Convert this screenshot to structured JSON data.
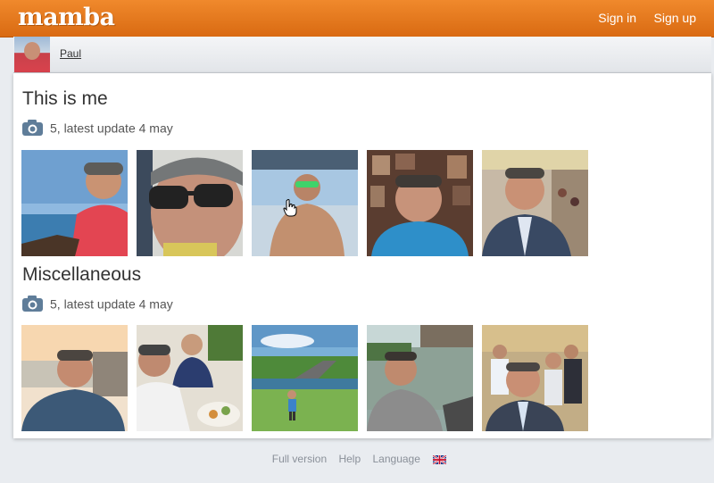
{
  "header": {
    "logo": "mamba",
    "sign_in": "Sign in",
    "sign_up": "Sign up",
    "brand_color": "#e57b20"
  },
  "user": {
    "name": "Paul"
  },
  "albums": [
    {
      "title": "This is me",
      "count_text": "5, latest update 4 may",
      "photos": [
        {
          "icon": "photo-man-red-shirt-sea"
        },
        {
          "icon": "photo-man-sunglasses-selfie"
        },
        {
          "icon": "photo-man-boat-green-glasses"
        },
        {
          "icon": "photo-man-blue-shirt-frames"
        },
        {
          "icon": "photo-man-suit-hall"
        }
      ]
    },
    {
      "title": "Miscellaneous",
      "count_text": "5, latest update 4 may",
      "photos": [
        {
          "icon": "photo-man-sunset-river"
        },
        {
          "icon": "photo-men-restaurant"
        },
        {
          "icon": "photo-road-landscape"
        },
        {
          "icon": "photo-man-lake"
        },
        {
          "icon": "photo-group-event"
        }
      ]
    }
  ],
  "footer": {
    "full_version": "Full version",
    "help": "Help",
    "language": "Language",
    "flag_icon": "uk-flag-icon"
  }
}
